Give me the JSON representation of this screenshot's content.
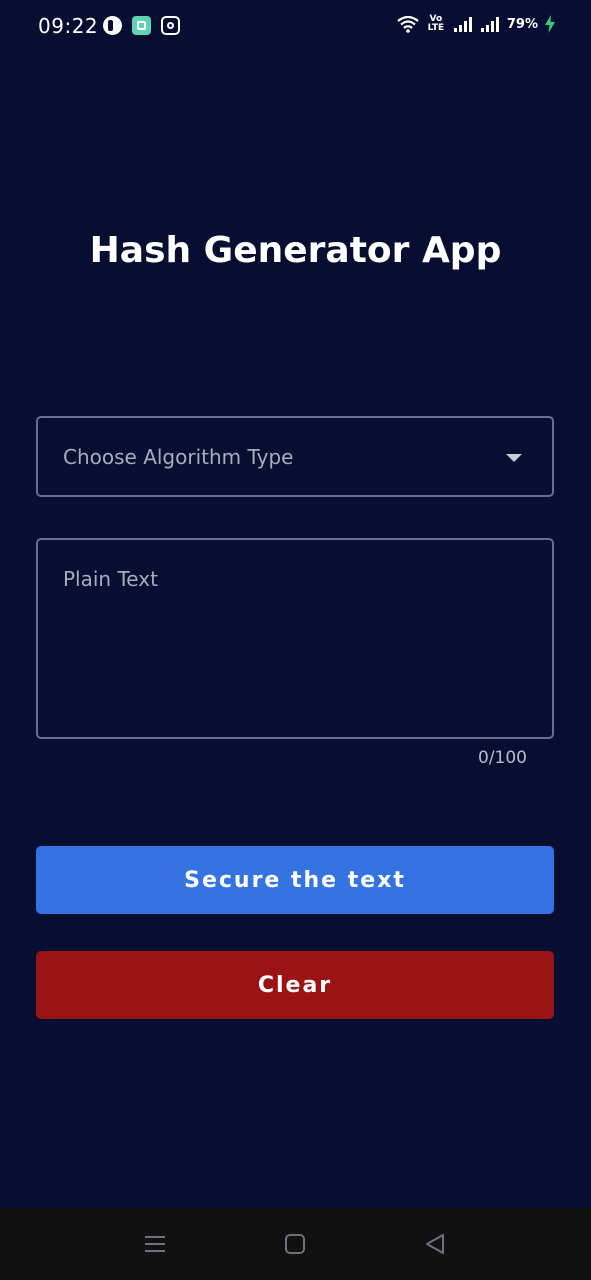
{
  "status_bar": {
    "time": "09:22",
    "battery_percent": "79%",
    "volte": "Vo LTE",
    "notification_icons": [
      "circle-app-icon",
      "calculator-app-icon",
      "instagram-icon"
    ],
    "indicator_icons": [
      "wifi-icon",
      "volte-icon",
      "signal-icon",
      "signal-icon",
      "charging-icon"
    ]
  },
  "header": {
    "title": "Hash Generator App"
  },
  "form": {
    "algorithm_select": {
      "placeholder": "Choose Algorithm Type",
      "icon": "dropdown-arrow-icon"
    },
    "plain_text": {
      "placeholder": "Plain Text",
      "value": "",
      "counter": "0/100"
    }
  },
  "actions": {
    "secure_label": "Secure the text",
    "clear_label": "Clear"
  },
  "colors": {
    "background": "#080e31",
    "primary_button": "#3573e3",
    "clear_button": "#9a1416",
    "field_border": "#6a6f8c"
  },
  "nav_bar": {
    "icons": [
      "menu-icon",
      "home-icon",
      "back-icon"
    ]
  }
}
